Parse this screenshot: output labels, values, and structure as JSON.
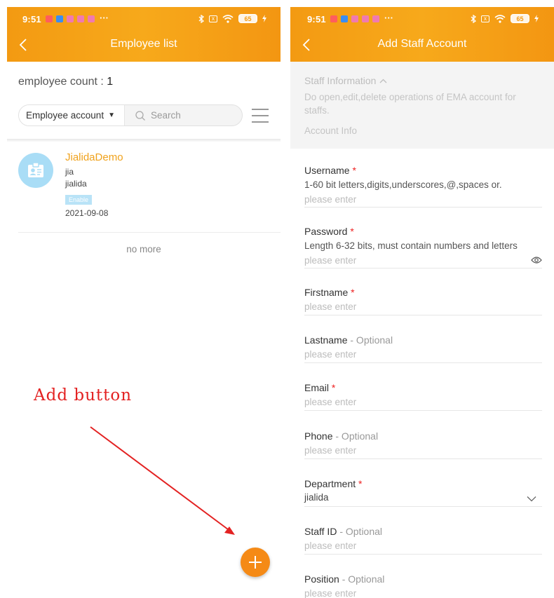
{
  "status_bar": {
    "time": "9:51",
    "more": "···",
    "battery": "65",
    "box_glyph": "x"
  },
  "left": {
    "title": "Employee list",
    "employee_count_label": "employee count : ",
    "employee_count": "1",
    "filter_select": "Employee account",
    "search_placeholder": "Search",
    "employee": {
      "name": "JialidaDemo",
      "line1": "jia",
      "line2": "jialida",
      "badge": "Enable",
      "date": "2021-09-08"
    },
    "no_more": "no more",
    "annotation": "Add button",
    "fab_glyph": "+"
  },
  "right": {
    "title": "Add Staff Account",
    "staff_section_title": "Staff Information",
    "staff_section_desc": "Do open,edit,delete operations of EMA account for staffs.",
    "account_info": "Account Info",
    "fields": {
      "username": {
        "label": "Username",
        "req": "*",
        "hint": "1-60 bit letters,digits,underscores,@,spaces or.",
        "placeholder": "please enter"
      },
      "password": {
        "label": "Password",
        "req": "*",
        "hint": "Length 6-32 bits, must contain numbers and letters",
        "placeholder": "please enter"
      },
      "firstname": {
        "label": "Firstname",
        "req": "*",
        "placeholder": "please enter"
      },
      "lastname": {
        "label": "Lastname",
        "opt": " - Optional",
        "placeholder": "please enter"
      },
      "email": {
        "label": "Email",
        "req": "*",
        "placeholder": "please enter"
      },
      "phone": {
        "label": "Phone",
        "opt": " - Optional",
        "placeholder": "please enter"
      },
      "department": {
        "label": "Department",
        "req": "*",
        "value": "jialida"
      },
      "staff_id": {
        "label": "Staff ID",
        "opt": " - Optional",
        "placeholder": "please enter"
      },
      "position": {
        "label": "Position",
        "opt": " - Optional",
        "placeholder": "please enter"
      }
    }
  },
  "colors": {
    "accent": "#f39a12",
    "fab": "#f58a16",
    "name": "#f0a21c",
    "annotation": "#e32222",
    "required": "#ee2222"
  }
}
